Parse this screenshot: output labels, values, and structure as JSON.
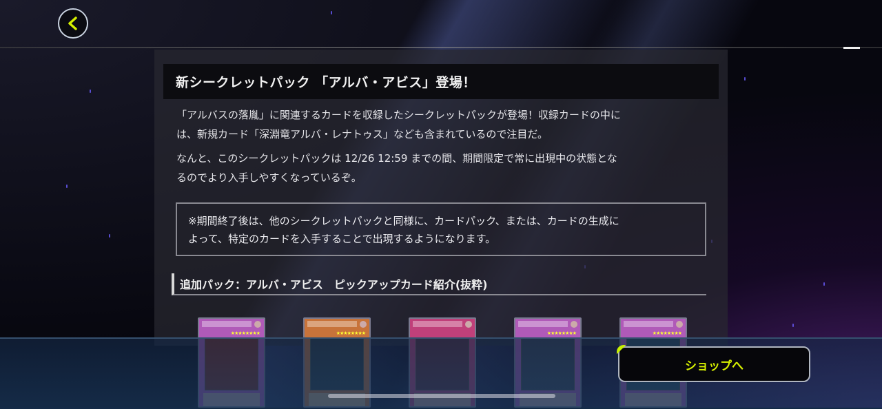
{
  "header": {
    "back_icon": "chevron-left-icon",
    "accent_color": "#c8f000"
  },
  "announcement": {
    "title": "新シークレットパック 「アルバ・アビス」登場！",
    "paragraph1_line1": "「アルバスの落胤」に関連するカードを収録したシークレットパックが登場！収録カードの中に",
    "paragraph1_line2": "は、新規カード「深淵竜アルバ・レナトゥス」なども含まれているので注目だ。",
    "paragraph2_line1": "なんと、このシークレットパックは 12/26 12:59 までの間、期間限定で常に出現中の状態とな",
    "paragraph2_line2": "るのでより入手しやすくなっているぞ。",
    "notice_line1": "※期間終了後は、他のシークレットパックと同様に、カードパック、または、カードの生成に",
    "notice_line2": "よって、特定のカードを入手することで出現するようになります。"
  },
  "pickup": {
    "heading": "追加パック：アルバ・アビス　ピックアップカード紹介(抜粋)",
    "cards": [
      {
        "frame_color": "#b05ab8",
        "art_color": "#7a2a20"
      },
      {
        "frame_color": "#c8733a",
        "art_color": "#2a3840"
      },
      {
        "frame_color": "#c0407a",
        "art_color": "#5a2a38"
      },
      {
        "frame_color": "#b05ab8",
        "art_color": "#3a4050"
      },
      {
        "frame_color": "#b05ab8",
        "art_color": "#2a4a5a"
      }
    ]
  },
  "footer": {
    "shop_button_label": "ショップへ"
  }
}
